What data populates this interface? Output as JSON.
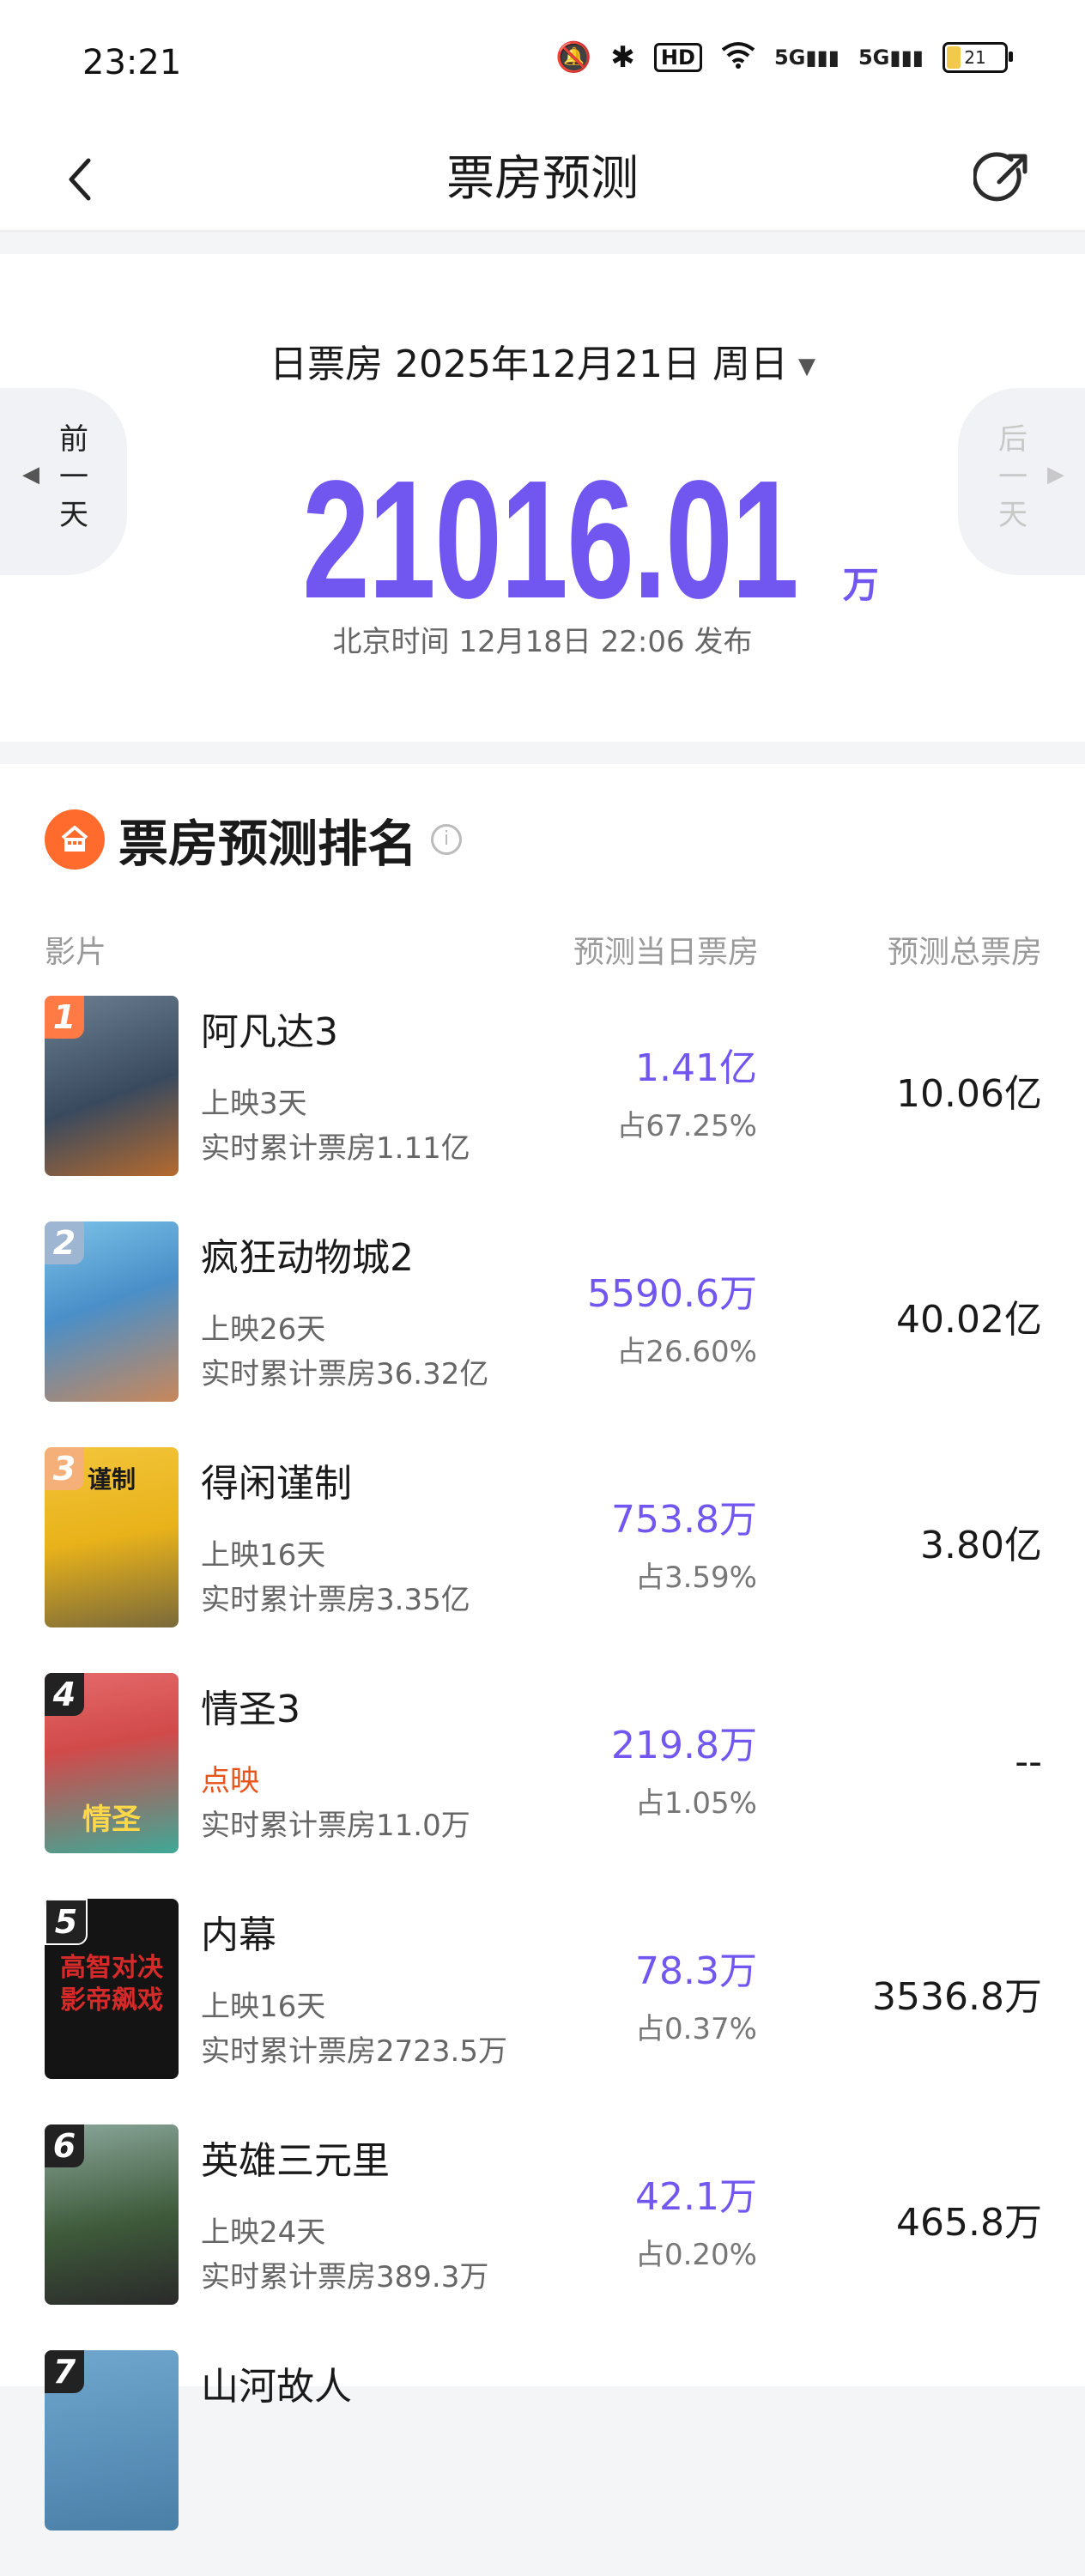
{
  "status": {
    "time": "23:21",
    "battery": "21",
    "hd": "HD",
    "signal": "5G"
  },
  "nav": {
    "title": "票房预测"
  },
  "summary": {
    "date_label": "日票房 2025年12月21日 周日",
    "prev_day": [
      "前",
      "一",
      "天"
    ],
    "next_day": [
      "后",
      "一",
      "天"
    ],
    "total": "21016.01",
    "unit": "万",
    "publish": "北京时间 12月18日 22:06 发布"
  },
  "ranking": {
    "title": "票房预测排名",
    "col_film": "影片",
    "col_day": "预测当日票房",
    "col_total": "预测总票房",
    "movies": [
      {
        "rank": "1",
        "name": "阿凡达3",
        "days": "上映3天",
        "cumulative": "实时累计票房1.11亿",
        "day_box": "1.41亿",
        "share": "占67.25%",
        "total": "10.06亿",
        "poster_text": "",
        "colors": {
          "badge": "#ff7a45",
          "bg": "#3a4a5e"
        }
      },
      {
        "rank": "2",
        "name": "疯狂动物城2",
        "days": "上映26天",
        "cumulative": "实时累计票房36.32亿",
        "day_box": "5590.6万",
        "share": "占26.60%",
        "total": "40.02亿",
        "poster_text": "",
        "colors": {
          "badge": "#9fb6d3",
          "bg": "#4a8fc8"
        }
      },
      {
        "rank": "3",
        "name": "得闲谨制",
        "days": "上映16天",
        "cumulative": "实时累计票房3.35亿",
        "day_box": "753.8万",
        "share": "占3.59%",
        "total": "3.80亿",
        "poster_text": "谨制",
        "colors": {
          "badge": "#f5b07a",
          "bg": "#e8b21a"
        }
      },
      {
        "rank": "4",
        "name": "情圣3",
        "days": "点映",
        "cumulative": "实时累计票房11.0万",
        "day_box": "219.8万",
        "share": "占1.05%",
        "total": "--",
        "poster_text": "情圣",
        "colors": {
          "badge": "#222222",
          "bg": "#d14a4a"
        }
      },
      {
        "rank": "5",
        "name": "内幕",
        "days": "上映16天",
        "cumulative": "实时累计票房2723.5万",
        "day_box": "78.3万",
        "share": "占0.37%",
        "total": "3536.8万",
        "poster_text": "高智对决 影帝飙戏",
        "colors": {
          "badge": "#222222",
          "bg": "#141414"
        }
      },
      {
        "rank": "6",
        "name": "英雄三元里",
        "days": "上映24天",
        "cumulative": "实时累计票房389.3万",
        "day_box": "42.1万",
        "share": "占0.20%",
        "total": "465.8万",
        "poster_text": "",
        "colors": {
          "badge": "#222222",
          "bg": "#3e5a3a"
        }
      },
      {
        "rank": "7",
        "name": "山河故人",
        "days": "",
        "cumulative": "",
        "day_box": "",
        "share": "",
        "total": "",
        "poster_text": "",
        "colors": {
          "badge": "#222222",
          "bg": "#4a7fa8"
        }
      }
    ]
  },
  "colors": {
    "accent": "#7156f0",
    "preview": "#e8541c",
    "logo": "#ff6b2c"
  }
}
